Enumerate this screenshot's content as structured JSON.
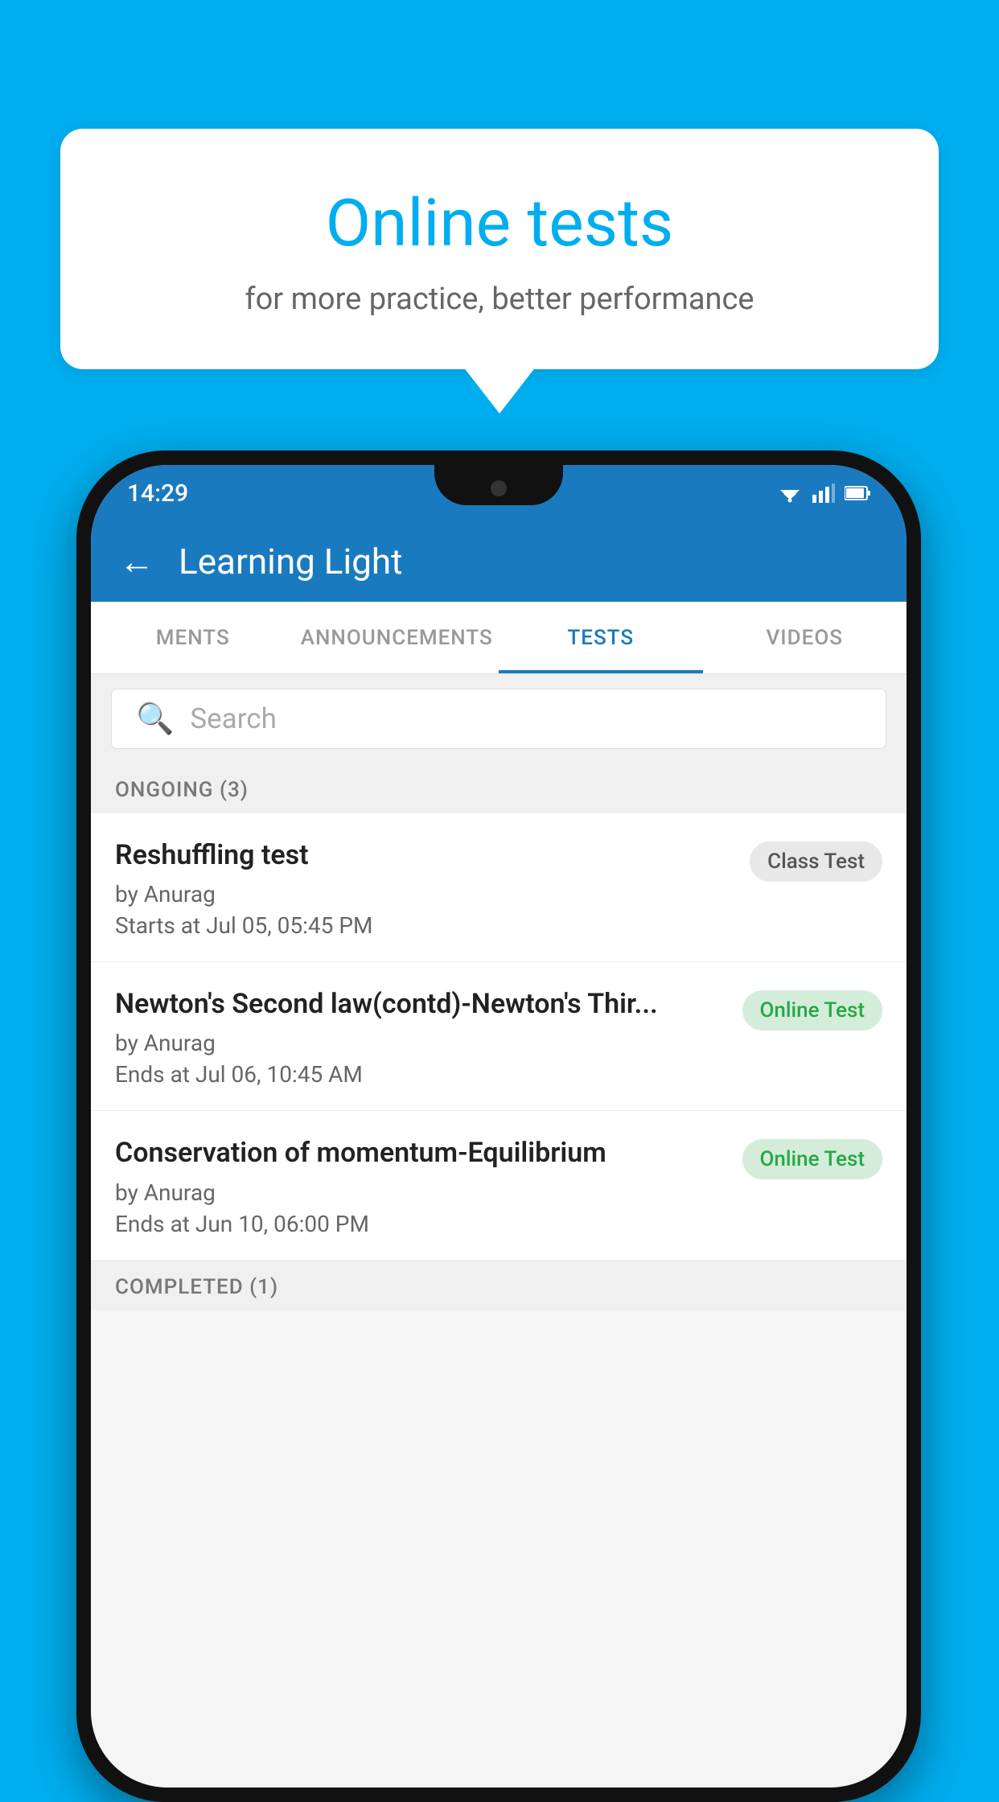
{
  "background_color": "#00AEEF",
  "bubble": {
    "title": "Online tests",
    "subtitle": "for more practice, better performance"
  },
  "phone": {
    "status_bar": {
      "time": "14:29"
    },
    "app_bar": {
      "title": "Learning Light",
      "back_label": "←"
    },
    "tabs": [
      {
        "label": "MENTS",
        "active": false
      },
      {
        "label": "ANNOUNCEMENTS",
        "active": false
      },
      {
        "label": "TESTS",
        "active": true
      },
      {
        "label": "VIDEOS",
        "active": false
      }
    ],
    "search": {
      "placeholder": "Search"
    },
    "ongoing_section": {
      "label": "ONGOING (3)"
    },
    "tests": [
      {
        "name": "Reshuffling test",
        "by": "by Anurag",
        "date": "Starts at  Jul 05, 05:45 PM",
        "badge": "Class Test",
        "badge_type": "class"
      },
      {
        "name": "Newton's Second law(contd)-Newton's Thir...",
        "by": "by Anurag",
        "date": "Ends at  Jul 06, 10:45 AM",
        "badge": "Online Test",
        "badge_type": "online"
      },
      {
        "name": "Conservation of momentum-Equilibrium",
        "by": "by Anurag",
        "date": "Ends at  Jun 10, 06:00 PM",
        "badge": "Online Test",
        "badge_type": "online"
      }
    ],
    "completed_section": {
      "label": "COMPLETED (1)"
    }
  }
}
